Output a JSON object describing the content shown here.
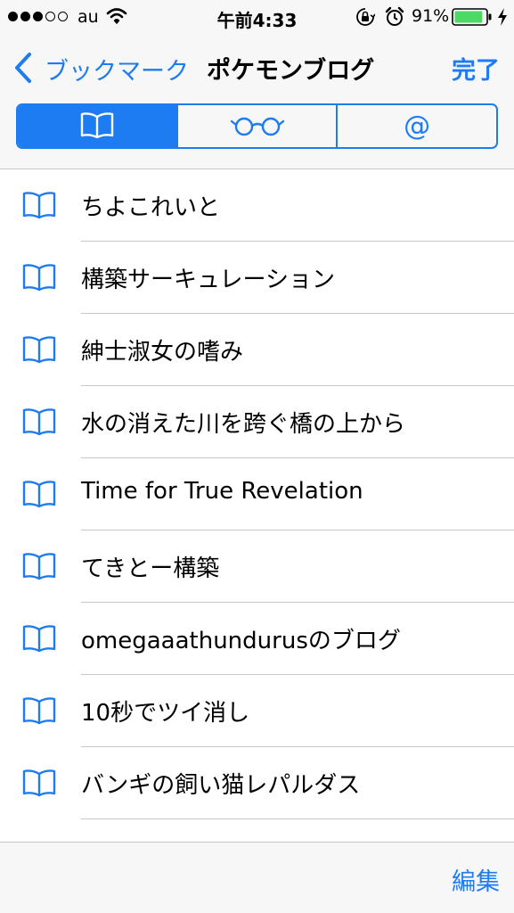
{
  "status_bar": {
    "carrier": "au",
    "time": "午前4:33",
    "battery_percent": "91%",
    "battery_level": 0.91,
    "signal_filled": 3,
    "signal_total": 5
  },
  "nav": {
    "back_label": "ブックマーク",
    "title": "ポケモンブログ",
    "done_label": "完了"
  },
  "segments": [
    {
      "icon": "book-icon",
      "selected": true
    },
    {
      "icon": "glasses-icon",
      "selected": false
    },
    {
      "icon": "at-sign-icon",
      "label": "@",
      "selected": false
    }
  ],
  "bookmarks": [
    {
      "title": "ちよこれいと"
    },
    {
      "title": "構築サーキュレーション"
    },
    {
      "title": "紳士淑女の嗜み"
    },
    {
      "title": "水の消えた川を跨ぐ橋の上から"
    },
    {
      "title": "Time for True Revelation"
    },
    {
      "title": "てきとー構築"
    },
    {
      "title": "omegaaathundurusのブログ"
    },
    {
      "title": "10秒でツイ消し"
    },
    {
      "title": "バンギの飼い猫レパルダス"
    }
  ],
  "toolbar": {
    "edit_label": "編集"
  },
  "colors": {
    "accent": "#1e7cf2",
    "battery": "#4cd964"
  }
}
